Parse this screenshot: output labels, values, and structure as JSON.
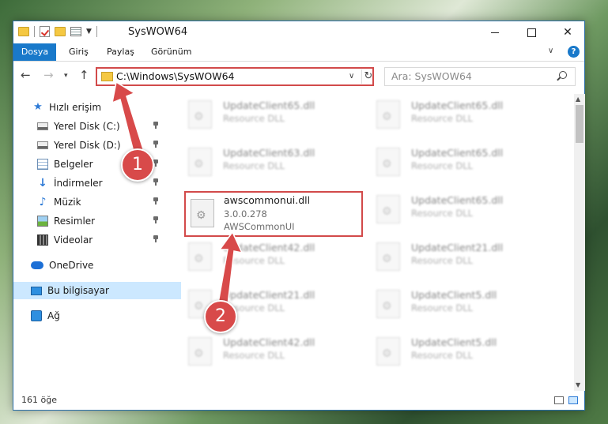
{
  "window": {
    "title": "SysWOW64",
    "controls": {
      "minimize": "–",
      "maximize": "□",
      "close": "✕"
    }
  },
  "ribbon": {
    "tabs": [
      "Dosya",
      "Giriş",
      "Paylaş",
      "Görünüm"
    ],
    "active_tab": "Dosya",
    "help": "?"
  },
  "nav": {
    "address": "C:\\Windows\\SysWOW64",
    "search_placeholder": "Ara: SysWOW64"
  },
  "sidebar": {
    "items": [
      {
        "label": "Hızlı erişim",
        "icon": "star-icon"
      },
      {
        "label": "Yerel Disk (C:)",
        "icon": "disk-icon",
        "pinned": true
      },
      {
        "label": "Yerel Disk (D:)",
        "icon": "disk-icon",
        "pinned": true
      },
      {
        "label": "Belgeler",
        "icon": "document-icon",
        "pinned": true
      },
      {
        "label": "İndirmeler",
        "icon": "download-icon",
        "pinned": true
      },
      {
        "label": "Müzik",
        "icon": "music-icon",
        "pinned": true
      },
      {
        "label": "Resimler",
        "icon": "pictures-icon",
        "pinned": true
      },
      {
        "label": "Videolar",
        "icon": "video-icon",
        "pinned": true
      },
      {
        "label": "OneDrive",
        "icon": "cloud-icon"
      },
      {
        "label": "Bu bilgisayar",
        "icon": "computer-icon",
        "selected": true
      },
      {
        "label": "Ağ",
        "icon": "network-icon"
      }
    ]
  },
  "files": {
    "highlighted": {
      "name": "awscommonui.dll",
      "version": "3.0.0.278",
      "description": "AWSCommonUI"
    },
    "left_column": [
      {
        "name": "UpdateClient65.dll",
        "type": "Resource DLL"
      },
      {
        "name": "UpdateClient63.dll",
        "type": "Resource DLL"
      },
      {
        "name": "UpdateClient42.dll",
        "type": "Resource DLL"
      },
      {
        "name": "UpdateClient21.dll",
        "type": "Resource DLL"
      },
      {
        "name": "UpdateClient42.dll",
        "type": "Resource DLL"
      }
    ],
    "right_column": [
      {
        "name": "UpdateClient65.dll",
        "type": "Resource DLL"
      },
      {
        "name": "UpdateClient65.dll",
        "type": "Resource DLL"
      },
      {
        "name": "UpdateClient65.dll",
        "type": "Resource DLL"
      },
      {
        "name": "UpdateClient21.dll",
        "type": "Resource DLL"
      },
      {
        "name": "UpdateClient5.dll",
        "type": "Resource DLL"
      },
      {
        "name": "UpdateClient5.dll",
        "type": "Resource DLL"
      }
    ]
  },
  "status": {
    "item_count": "161 öğe"
  },
  "callouts": {
    "step1": "1",
    "step2": "2"
  },
  "colors": {
    "accent": "#1979ca",
    "highlight": "#d24a4a",
    "selected": "#cce8ff"
  }
}
